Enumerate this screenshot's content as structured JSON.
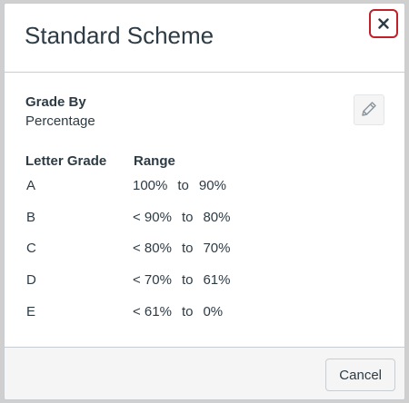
{
  "modal": {
    "title": "Standard Scheme",
    "close_label": "×",
    "grade_by_label": "Grade By",
    "grade_by_value": "Percentage",
    "columns": {
      "letter": "Letter Grade",
      "range": "Range"
    },
    "grades": [
      {
        "letter": "A",
        "upper": "100%",
        "to": "to",
        "lower": "90%"
      },
      {
        "letter": "B",
        "upper": "< 90%",
        "to": "to",
        "lower": "80%"
      },
      {
        "letter": "C",
        "upper": "< 80%",
        "to": "to",
        "lower": "70%"
      },
      {
        "letter": "D",
        "upper": "< 70%",
        "to": "to",
        "lower": "61%"
      },
      {
        "letter": "E",
        "upper": "< 61%",
        "to": "to",
        "lower": "0%"
      }
    ],
    "cancel_label": "Cancel"
  },
  "icons": {
    "close": "close-icon",
    "edit": "pencil-icon"
  },
  "colors": {
    "close_focus_ring": "#c0202a",
    "text": "#2d3b45",
    "border": "#c7cdd1",
    "footer_bg": "#f5f5f5"
  }
}
